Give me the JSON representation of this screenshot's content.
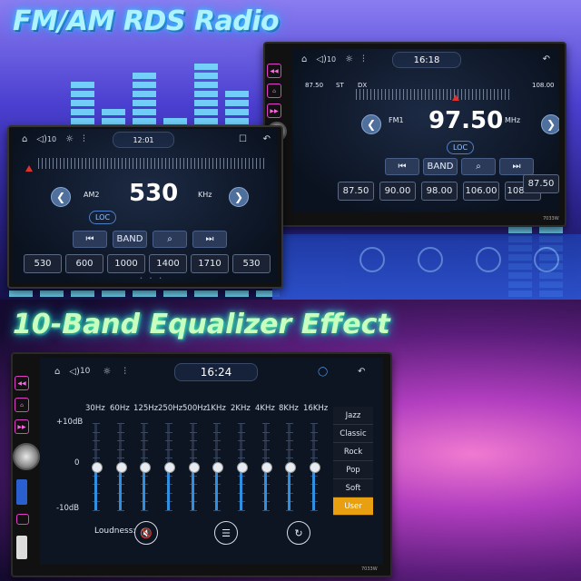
{
  "banner_top": {
    "title": "FM/AM RDS Radio"
  },
  "banner_bottom": {
    "title": "10-Band Equalizer Effect"
  },
  "fm": {
    "status": {
      "volume": "10",
      "clock": "16:18"
    },
    "range_low": "87.50",
    "st": "ST",
    "dx": "DX",
    "range_high": "108.00",
    "band": "FM1",
    "frequency": "97.50",
    "unit": "MHz",
    "loc": "LOC",
    "controls": {
      "band": "BAND"
    },
    "presets": [
      "87.50",
      "90.00",
      "98.00",
      "106.00",
      "108.00",
      "87.50"
    ],
    "model": "7033W"
  },
  "am": {
    "status": {
      "volume": "10",
      "clock": "12:01"
    },
    "band": "AM2",
    "frequency": "530",
    "unit": "KHz",
    "loc": "LOC",
    "controls": {
      "band": "BAND"
    },
    "presets": [
      "530",
      "600",
      "1000",
      "1400",
      "1710",
      "530"
    ]
  },
  "eq": {
    "status": {
      "volume": "10",
      "clock": "16:24"
    },
    "db_labels": {
      "top": "+10dB",
      "mid": "0",
      "bottom": "-10dB"
    },
    "bands": [
      {
        "freq": "30Hz",
        "level": 0
      },
      {
        "freq": "60Hz",
        "level": 0
      },
      {
        "freq": "125Hz",
        "level": 0
      },
      {
        "freq": "250Hz",
        "level": 0
      },
      {
        "freq": "500Hz",
        "level": 0
      },
      {
        "freq": "1KHz",
        "level": 0
      },
      {
        "freq": "2KHz",
        "level": 0
      },
      {
        "freq": "4KHz",
        "level": 0
      },
      {
        "freq": "8KHz",
        "level": 0
      },
      {
        "freq": "16KHz",
        "level": 0
      }
    ],
    "presets": [
      "Jazz",
      "Classic",
      "Rock",
      "Pop",
      "Soft",
      "User"
    ],
    "active_preset": "User",
    "loudness_label": "Loudness:",
    "model": "7033W",
    "accent_color": "#e8a010"
  }
}
